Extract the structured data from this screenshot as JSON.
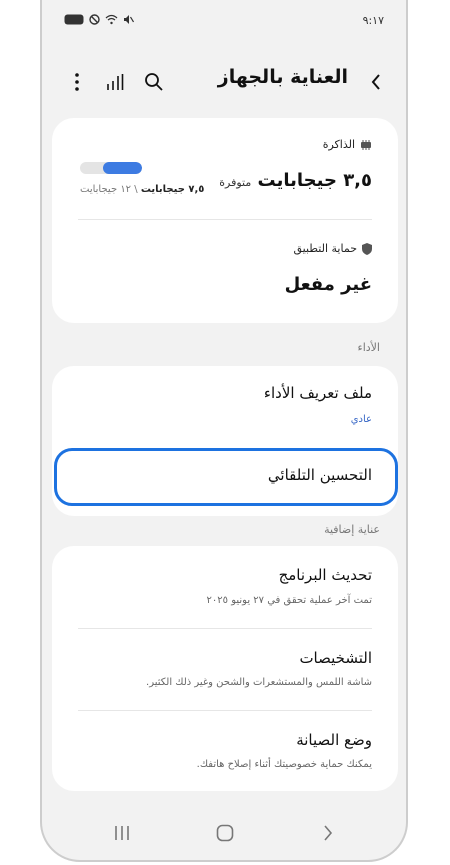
{
  "status_bar": {
    "time": "٩:١٧"
  },
  "appbar": {
    "title": "العناية بالجهاز"
  },
  "memory": {
    "label": "الذاكرة",
    "available_value": "٣,٥ جيجابايت",
    "available_suffix": "متوفرة",
    "used": "٧,٥ جيجابايت",
    "total": "\\ ١٢ جيجابايت",
    "usage_fraction": 0.625
  },
  "app_protection": {
    "label": "حماية التطبيق",
    "value": "غير مفعل"
  },
  "performance": {
    "section_label": "الأداء",
    "profile_title": "ملف تعريف الأداء",
    "profile_value": "عادي",
    "auto_opt_title": "التحسين التلقائي"
  },
  "extra": {
    "section_label": "عناية إضافية",
    "items": [
      {
        "title": "تحديث البرنامج",
        "subtitle": "تمت آخر عملية تحقق في ٢٧ يونيو ٢٠٢٥"
      },
      {
        "title": "التشخيصات",
        "subtitle": "شاشة اللمس والمستشعرات والشحن وغير ذلك الكثير."
      },
      {
        "title": "وضع الصيانة",
        "subtitle": "يمكنك حماية خصوصيتك أثناء إصلاح هاتفك."
      }
    ]
  },
  "colors": {
    "accent": "#1d72e0",
    "meter_fill": "#3d7be2",
    "link_blue": "#3767c6"
  }
}
